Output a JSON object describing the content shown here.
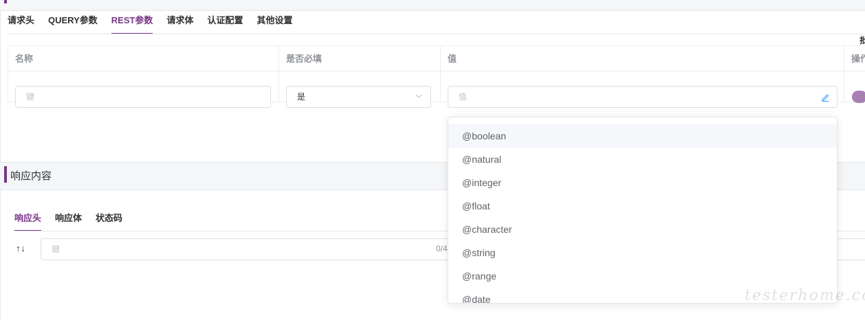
{
  "request": {
    "tabs": [
      {
        "label": "请求头"
      },
      {
        "label": "QUERY参数"
      },
      {
        "label": "REST参数"
      },
      {
        "label": "请求体"
      },
      {
        "label": "认证配置"
      },
      {
        "label": "其他设置"
      }
    ],
    "batch_label": "批",
    "table": {
      "headers": {
        "name": "名称",
        "required": "是否必填",
        "value": "值",
        "ops": "操作"
      },
      "row": {
        "key_placeholder": "键",
        "required_value": "是",
        "value_placeholder": "值",
        "enabled": true
      }
    }
  },
  "value_dropdown": {
    "options": [
      "@boolean",
      "@natural",
      "@integer",
      "@float",
      "@character",
      "@string",
      "@range",
      "@date"
    ]
  },
  "response": {
    "title": "响应内容",
    "tabs": [
      {
        "label": "响应头"
      },
      {
        "label": "响应体"
      },
      {
        "label": "状态码"
      }
    ],
    "sort_glyph": "↑↓",
    "key_placeholder": "键",
    "counter": "0/4"
  },
  "watermark": "testerhome.com",
  "colors": {
    "accent": "#783887"
  }
}
